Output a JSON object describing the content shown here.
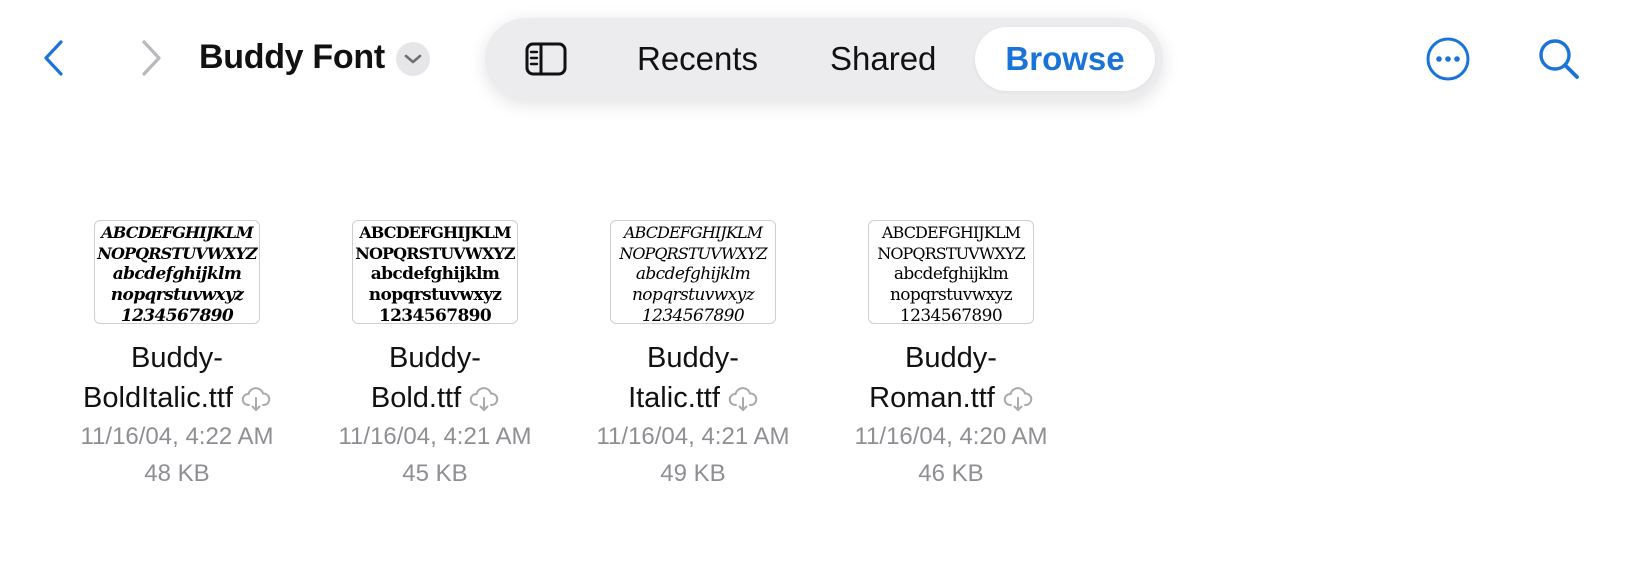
{
  "header": {
    "title": "Buddy Font",
    "back_icon": "chevron-left-icon",
    "forward_icon": "chevron-right-icon",
    "title_menu_icon": "chevron-down-icon"
  },
  "tabs": {
    "sidebar_icon": "sidebar-icon",
    "recents": "Recents",
    "shared": "Shared",
    "browse": "Browse",
    "selected": "Browse"
  },
  "actions": {
    "more_icon": "ellipsis-circle-icon",
    "search_icon": "search-icon"
  },
  "colors": {
    "accent": "#1a73d6",
    "secondary_text": "#8e8e93"
  },
  "files": [
    {
      "name_line1": "Buddy-",
      "name_line2": "BoldItalic.ttf",
      "date": "11/16/04, 4:22 AM",
      "size": "48 KB",
      "preview": [
        "ABCDEFGHIJKLM",
        "NOPQRSTUVWXYZ",
        "abcdefghijklm",
        "nopqrstuvwxyz",
        "1234567890"
      ]
    },
    {
      "name_line1": "Buddy-",
      "name_line2": "Bold.ttf",
      "date": "11/16/04, 4:21 AM",
      "size": "45 KB",
      "preview": [
        "ABCDEFGHIJKLM",
        "NOPQRSTUVWXYZ",
        "abcdefghijklm",
        "nopqrstuvwxyz",
        "1234567890"
      ]
    },
    {
      "name_line1": "Buddy-",
      "name_line2": "Italic.ttf",
      "date": "11/16/04, 4:21 AM",
      "size": "49 KB",
      "preview": [
        "ABCDEFGHIJKLM",
        "NOPQRSTUVWXYZ",
        "abcdefghijklm",
        "nopqrstuvwxyz",
        "1234567890"
      ]
    },
    {
      "name_line1": "Buddy-",
      "name_line2": "Roman.ttf",
      "date": "11/16/04, 4:20 AM",
      "size": "46 KB",
      "preview": [
        "ABCDEFGHIJKLM",
        "NOPQRSTUVWXYZ",
        "abcdefghijklm",
        "nopqrstuvwxyz",
        "1234567890"
      ]
    }
  ],
  "file_status_icon": "cloud-download-icon"
}
